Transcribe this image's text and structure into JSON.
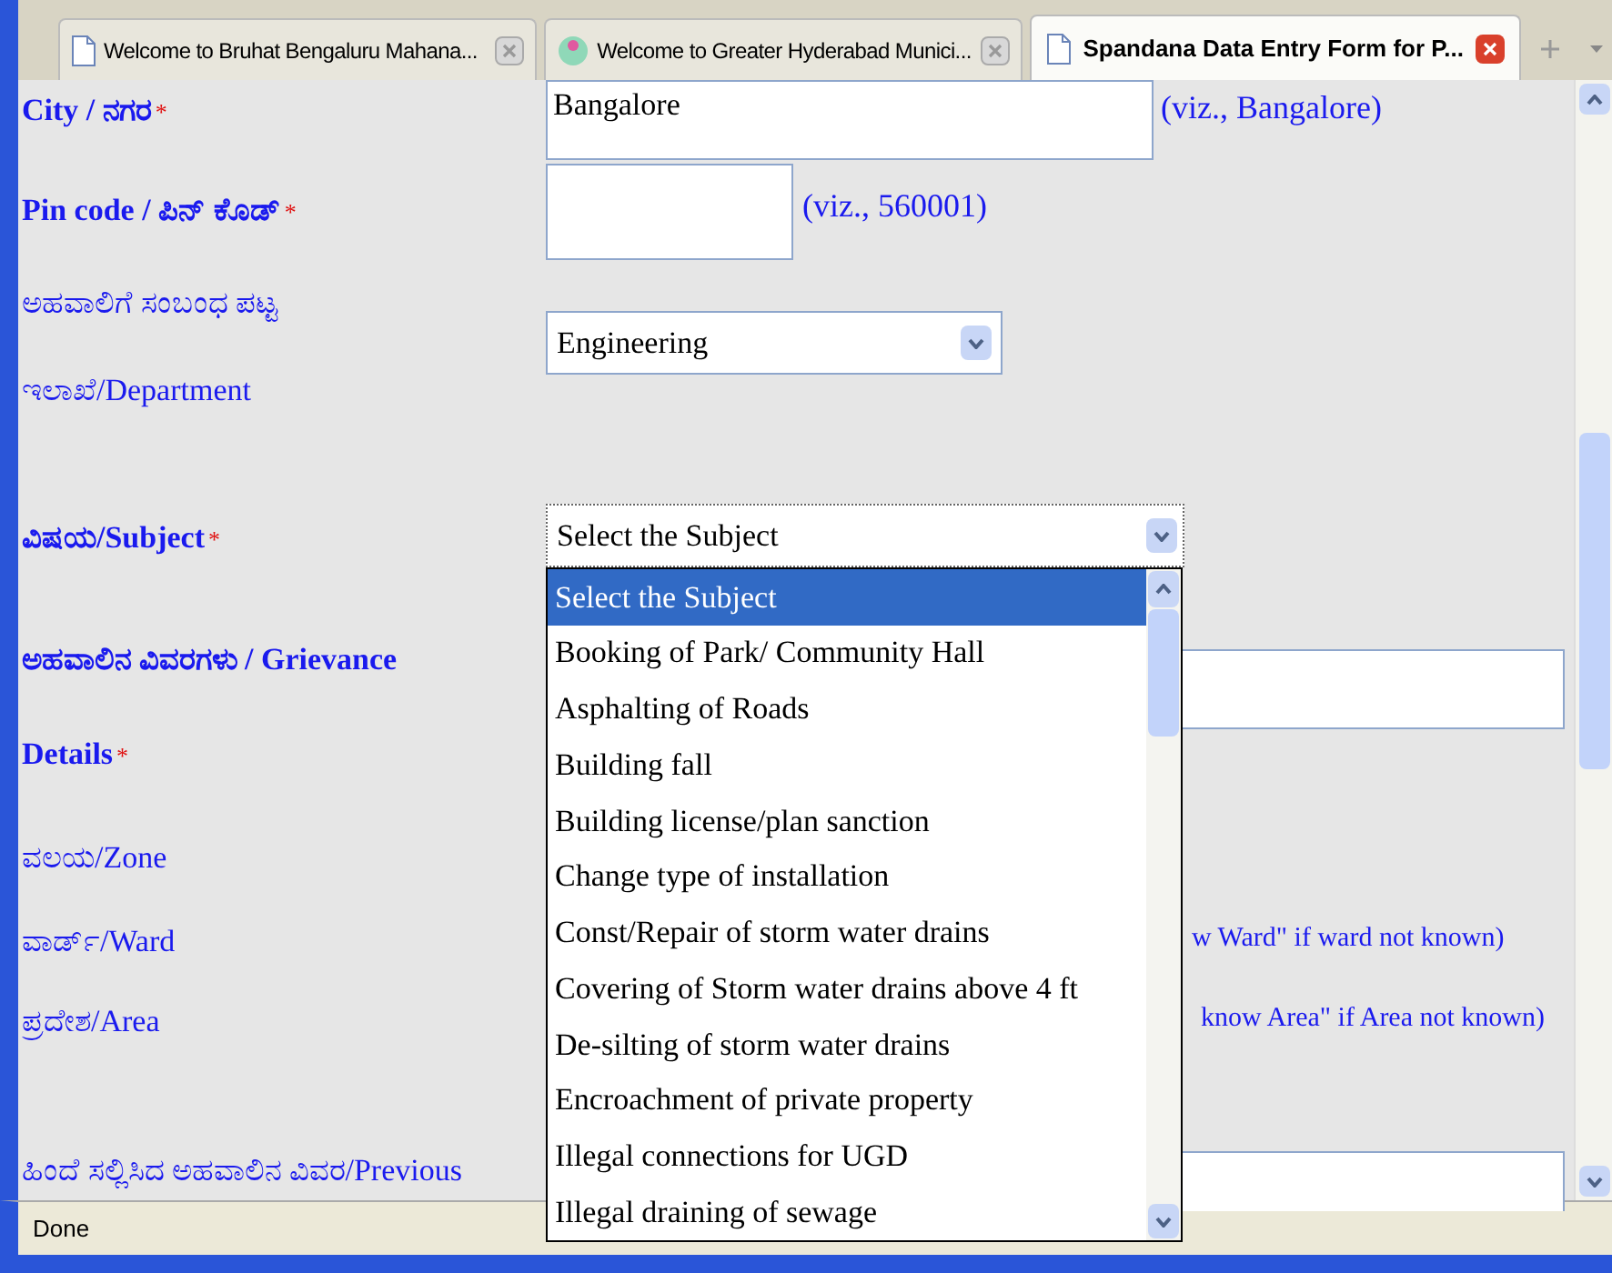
{
  "tabs": [
    {
      "label": "Welcome to Bruhat Bengaluru Mahana...",
      "kind": "page",
      "selected": false
    },
    {
      "label": "Welcome to Greater Hyderabad Munici...",
      "kind": "logo",
      "selected": false
    },
    {
      "label": "Spandana Data Entry Form for P...",
      "kind": "page",
      "selected": true
    }
  ],
  "form": {
    "city": {
      "label": "City / ನಗರ",
      "required_mark": "*",
      "value": "Bangalore",
      "hint": "(viz., Bangalore)"
    },
    "pin": {
      "label": "Pin code / ಪಿನ್ ಕೊಡ್",
      "required_mark": "*",
      "hint": "(viz., 560001)"
    },
    "department": {
      "label_lines": [
        "ಅಹವಾಲಿಗೆ ಸಂಬಂಧ ಪಟ್ಟ",
        "ಇಲಾಖೆ/Department"
      ],
      "value": "Engineering"
    },
    "subject": {
      "label": "ವಿಷಯ/Subject",
      "required_mark": "*",
      "value": "Select the Subject",
      "expanded": true,
      "options": [
        {
          "label": "Select the Subject",
          "selected": true
        },
        {
          "label": "Booking of Park/ Community Hall",
          "selected": false
        },
        {
          "label": "Asphalting of Roads",
          "selected": false
        },
        {
          "label": "Building fall",
          "selected": false
        },
        {
          "label": "Building license/plan sanction",
          "selected": false
        },
        {
          "label": "Change type of installation",
          "selected": false
        },
        {
          "label": "Const/Repair of storm water drains",
          "selected": false
        },
        {
          "label": "Covering of Storm water drains above 4 ft",
          "selected": false
        },
        {
          "label": "De-silting of storm water drains",
          "selected": false
        },
        {
          "label": "Encroachment of private property",
          "selected": false
        },
        {
          "label": "Illegal connections for UGD",
          "selected": false
        },
        {
          "label": "Illegal draining of sewage",
          "selected": false
        }
      ]
    },
    "grievance": {
      "label_lines": [
        "ಅಹವಾಲಿನ ವಿವರಗಳು / Grievance",
        "Details"
      ],
      "required_mark": "*"
    },
    "zone": {
      "label": "ವಲಯ/Zone"
    },
    "ward": {
      "label": "ವಾರ್ಡ್/Ward",
      "hint": "w Ward\" if ward not known)"
    },
    "area": {
      "label": "ಪ್ರದೇಶ/Area",
      "hint": "know Area\" if Area not known)"
    },
    "previous": {
      "label": "ಹಿಂದೆ ಸಲ್ಲಿಸಿದ ಅಹವಾಲಿನ ವಿವರ/Previous"
    }
  },
  "status_bar": "Done"
}
